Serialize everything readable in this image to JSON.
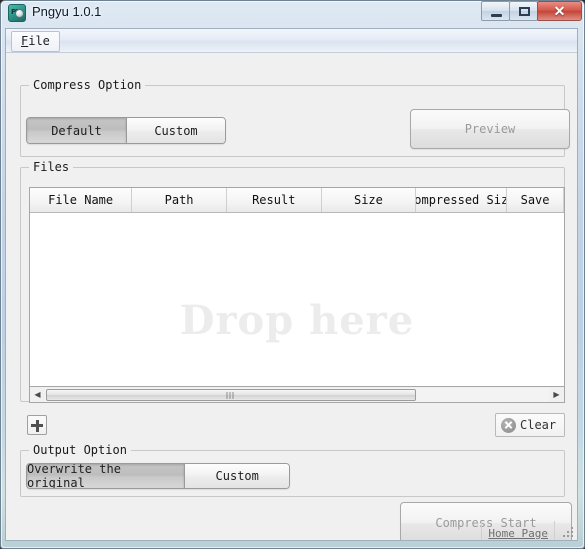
{
  "window": {
    "title": "Pngyu 1.0.1",
    "icon_name": "app-icon",
    "buttons": {
      "minimize": "minimize-button",
      "maximize": "maximize-button",
      "close_glyph": "✕"
    }
  },
  "menubar": {
    "items": [
      {
        "label": "File",
        "mnemonic": "F",
        "rest": "ile"
      }
    ]
  },
  "compress_option": {
    "title": "Compress Option",
    "modes": [
      {
        "label": "Default",
        "selected": true
      },
      {
        "label": "Custom",
        "selected": false
      }
    ],
    "preview_button": {
      "label": "Preview",
      "enabled": false
    }
  },
  "files": {
    "title": "Files",
    "columns": [
      "File Name",
      "Path",
      "Result",
      "Size",
      "Compressed Size",
      "Save"
    ],
    "rows": [],
    "placeholder": "Drop here",
    "scrollbar": {
      "left_arrow": "◀",
      "right_arrow": "▶"
    },
    "add_button": {
      "icon": "plus-icon",
      "label": ""
    },
    "clear_button": {
      "icon": "circle-x-icon",
      "label": "Clear"
    }
  },
  "output_option": {
    "title": "Output Option",
    "modes": [
      {
        "label": "Overwrite the original",
        "selected": true
      },
      {
        "label": "Custom",
        "selected": false
      }
    ]
  },
  "actions": {
    "compress_start": {
      "label": "Compress Start",
      "enabled": false
    }
  },
  "statusbar": {
    "home_page_link": "Home Page",
    "resize_grip": "resize-grip"
  },
  "colors": {
    "accent_close": "#c4453a",
    "window_glass": "#c2d3e6",
    "client_bg": "#f0f0f0",
    "placeholder_text": "#ececec",
    "selected_segment": "#c6c6c6"
  }
}
